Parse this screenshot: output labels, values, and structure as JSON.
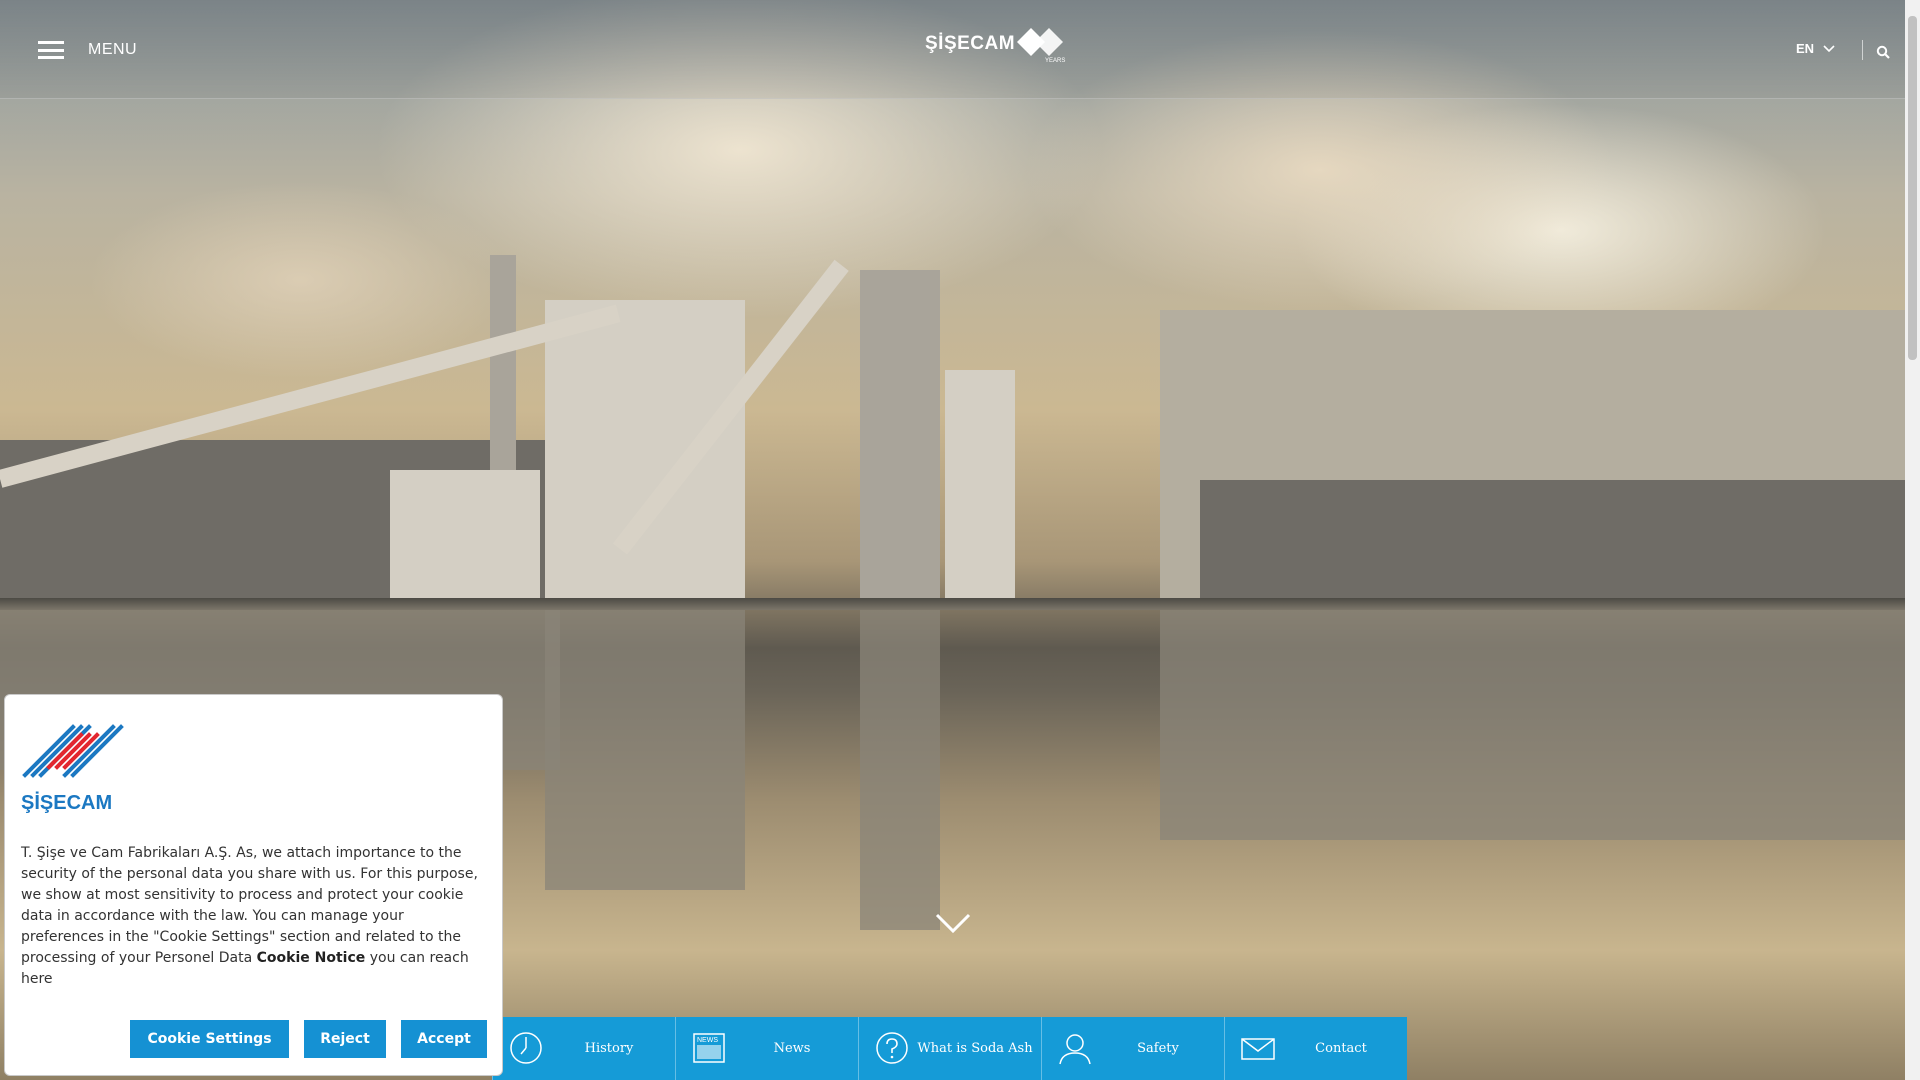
{
  "header": {
    "menu_label": "MENU",
    "logo_text": "ŞİŞECAM",
    "logo_badge_text": "YEARS",
    "language": "EN",
    "icons": {
      "menu": "hamburger-icon",
      "lang_toggle": "chevron-down-icon",
      "search": "search-icon"
    }
  },
  "hero": {
    "scroll_icon": "chevron-down-icon"
  },
  "quick_links": [
    {
      "label": "History",
      "icon": "clock-icon"
    },
    {
      "label": "News",
      "icon": "news-icon",
      "icon_text": "NEWS"
    },
    {
      "label": "What is Soda Ash",
      "icon": "question-icon"
    },
    {
      "label": "Safety",
      "icon": "user-icon"
    },
    {
      "label": "Contact",
      "icon": "envelope-icon"
    }
  ],
  "cookie": {
    "logo_text": "ŞİŞECAM",
    "text_before": "T. Şişe ve Cam Fabrikaları A.Ş. As, we attach importance to the security of the personal data you share with us. For this purpose, we show at most sensitivity to process and protect your cookie data in accordance with the law. You can manage your preferences in the \"Cookie Settings\" section and related to the processing of your Personel Data ",
    "link_text": "Cookie Notice",
    "text_after": " you can reach here",
    "buttons": {
      "settings": "Cookie Settings",
      "reject": "Reject",
      "accept": "Accept"
    }
  },
  "colors": {
    "accent_blue": "#159bd7",
    "button_blue": "#1591d3",
    "logo_red": "#e3262f",
    "logo_blue": "#1b78c2"
  }
}
